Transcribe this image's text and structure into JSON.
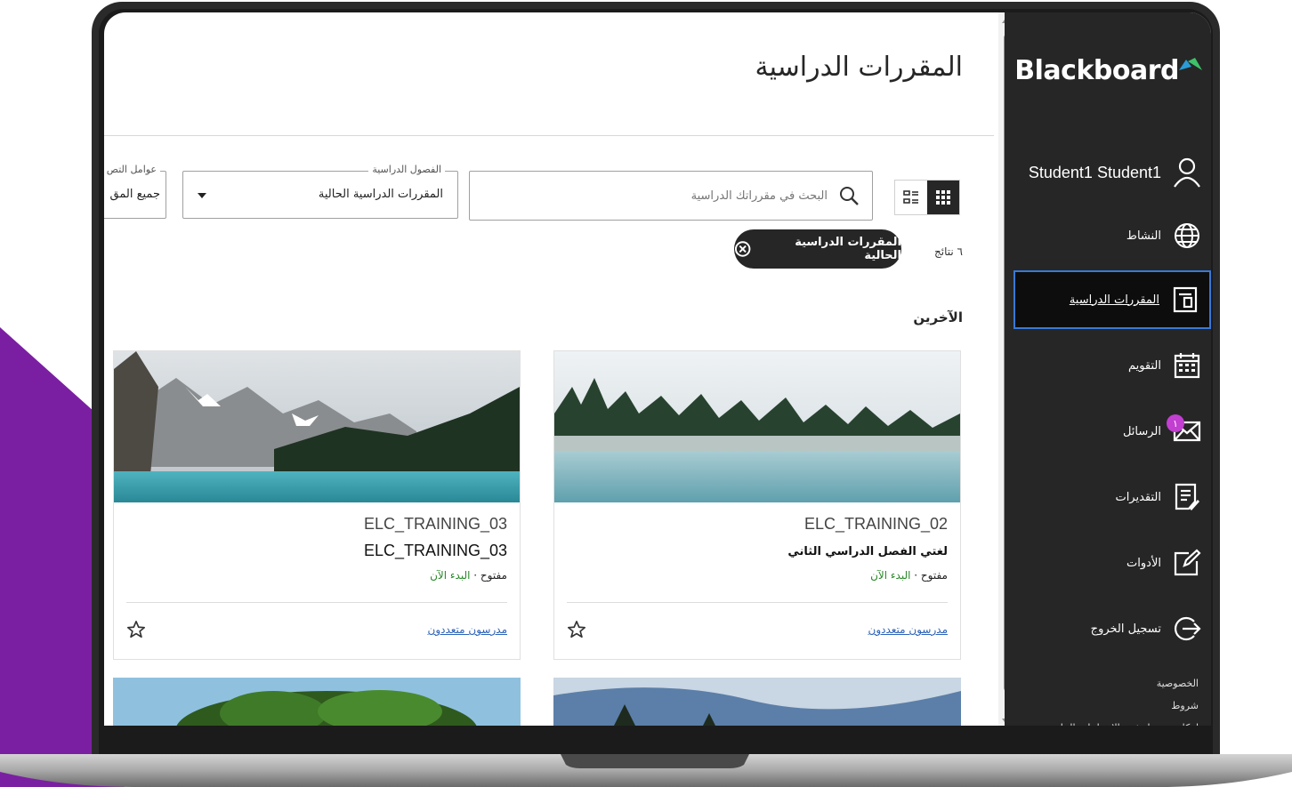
{
  "brand": {
    "name": "Blackboard",
    "accent": "#2b9bd6"
  },
  "colors": {
    "sidebar_bg": "#262626",
    "active_border": "#3a78d6",
    "badge": "#c23fd1",
    "link": "#2c62b8",
    "open_green": "#2a8a2a",
    "backdrop_purple": "#7b1fa2"
  },
  "sidebar": {
    "user": {
      "name": "Student1 Student1",
      "icon": "user-icon"
    },
    "items": [
      {
        "label": "النشاط",
        "icon": "globe-icon",
        "active": false
      },
      {
        "label": "المقررات الدراسية",
        "icon": "courses-icon",
        "active": true
      },
      {
        "label": "التقويم",
        "icon": "calendar-icon",
        "active": false
      },
      {
        "label": "الرسائل",
        "icon": "mail-icon",
        "active": false,
        "badge": "١"
      },
      {
        "label": "التقديرات",
        "icon": "grades-icon",
        "active": false
      },
      {
        "label": "الأدوات",
        "icon": "tools-icon",
        "active": false
      },
      {
        "label": "تسجيل الخروج",
        "icon": "logout-icon",
        "active": false
      }
    ],
    "footer": [
      "الخصوصية",
      "شروط",
      "إمكانية وصول ذوي الاحتياجات الخاصة"
    ]
  },
  "main": {
    "title": "المقررات الدراسية",
    "search": {
      "placeholder": "البحث في مقرراتك الدراسية",
      "value": ""
    },
    "term_filter": {
      "legend": "الفصول الدراسية",
      "value": "المقررات الدراسية الحالية"
    },
    "other_filter": {
      "legend": "عوامل التص",
      "value": "جميع المق"
    },
    "results": "٦ نتائج",
    "chip": "المقررات الدراسية الحالية",
    "section": "الآخرين",
    "courses": [
      {
        "code": "ELC_TRAINING_02",
        "title": "لغتي الفصل الدراسي الثاني",
        "status": "مفتوح",
        "start": "البدء الآن",
        "instructors": "مدرسون متعددون"
      },
      {
        "code": "ELC_TRAINING_03",
        "title": "ELC_TRAINING_03",
        "status": "مفتوح",
        "start": "البدء الآن",
        "instructors": "مدرسون متعددون"
      }
    ]
  }
}
